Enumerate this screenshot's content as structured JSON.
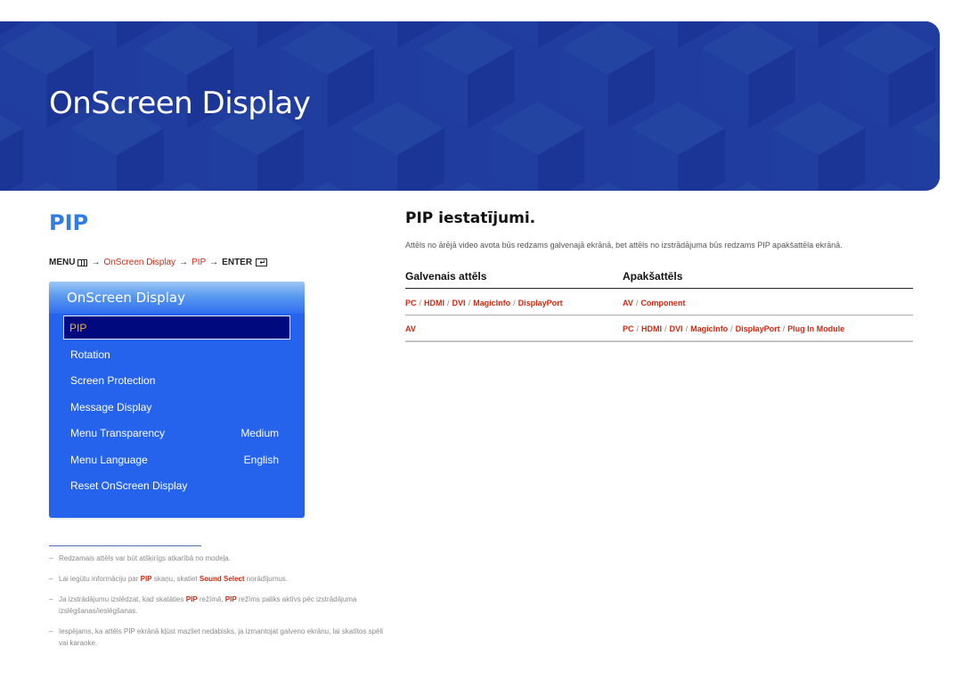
{
  "banner": {
    "title": "OnScreen Display",
    "bg_color": "#1f3c9e"
  },
  "section": {
    "title": "PIP",
    "title_color": "#2f7de6"
  },
  "menu_path": {
    "menu": "MENU",
    "menu_icon": "menu-grid-icon",
    "arrow": "→",
    "step1": "OnScreen Display",
    "step2": "PIP",
    "enter": "ENTER",
    "enter_icon": "enter-icon",
    "highlight_color": "#cc2a12"
  },
  "osd": {
    "header": "OnScreen Display",
    "items": [
      {
        "label": "PIP",
        "value": "",
        "selected": true
      },
      {
        "label": "Rotation",
        "value": ""
      },
      {
        "label": "Screen Protection",
        "value": ""
      },
      {
        "label": "Message Display",
        "value": ""
      },
      {
        "label": "Menu Transparency",
        "value": "Medium"
      },
      {
        "label": "Menu Language",
        "value": "English"
      },
      {
        "label": "Reset OnScreen Display",
        "value": ""
      }
    ],
    "bg_color": "#2563ec",
    "selected_bg": "#000a7e",
    "selected_text_color": "#f2b136"
  },
  "footnotes": [
    {
      "parts": [
        {
          "t": "Redzamais attēls var būt atšķirīgs atkarībā no modeļa."
        }
      ]
    },
    {
      "parts": [
        {
          "t": "Lai iegūtu informāciju par "
        },
        {
          "t": "PIP",
          "hl": true
        },
        {
          "t": " skaņu, skatiet "
        },
        {
          "t": "Sound Select",
          "hl": true
        },
        {
          "t": " norādījumus."
        }
      ]
    },
    {
      "parts": [
        {
          "t": "Ja izstrādājumu izslēdzat, kad skatāties "
        },
        {
          "t": "PIP",
          "hl": true
        },
        {
          "t": " režīmā, "
        },
        {
          "t": "PIP",
          "hl": true
        },
        {
          "t": " režīms paliks aktīvs pēc izstrādājuma izslēgšanas/ieslēgšanas."
        }
      ]
    },
    {
      "parts": [
        {
          "t": "Iespējams, ka attēls PIP ekrānā kļūst mazliet nedabisks, ja izmantojat galveno ekrānu, lai skatītos spēli vai karaoke."
        }
      ]
    }
  ],
  "settings": {
    "title": "PIP iestatījumi.",
    "description": "Attēls no ārējā video avota būs redzams galvenajā ekrānā, bet attēls no izstrādājuma būs redzams PIP apakšattēla ekrānā.",
    "table": {
      "headers": [
        "Galvenais attēls",
        "Apakšattēls"
      ],
      "rows": [
        {
          "main": [
            "PC",
            "HDMI",
            "DVI",
            "MagicInfo",
            "DisplayPort"
          ],
          "sub": [
            "AV",
            "Component"
          ]
        },
        {
          "main": [
            "AV"
          ],
          "sub": [
            "PC",
            "HDMI",
            "DVI",
            "MagicInfo",
            "DisplayPort",
            "Plug In Module"
          ]
        }
      ],
      "separator": "/"
    }
  }
}
